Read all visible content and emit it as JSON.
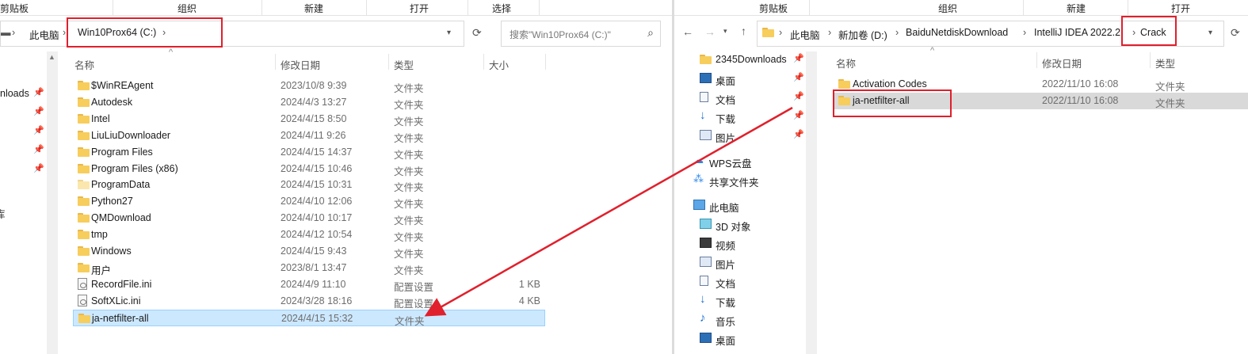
{
  "left": {
    "ribbon": {
      "clipboard": "剪贴板",
      "organize": "组织",
      "new": "新建",
      "open": "打开",
      "select": "选择"
    },
    "address": {
      "this_pc": "此电脑",
      "drive": "Win10Prox64 (C:)",
      "chev": "›"
    },
    "search_placeholder": "搜索\"Win10Prox64 (C:)\"",
    "nav": [
      {
        "label": "nloads",
        "pin": "📌"
      },
      {
        "label": "",
        "pin": "📌"
      },
      {
        "label": "",
        "pin": "📌"
      },
      {
        "label": "",
        "pin": "📌"
      },
      {
        "label": "",
        "pin": "📌"
      }
    ],
    "nav_fragment": "库",
    "columns": {
      "name": "名称",
      "date": "修改日期",
      "type": "类型",
      "size": "大小"
    },
    "rows": [
      {
        "name": "$WinREAgent",
        "date": "2023/10/8 9:39",
        "type": "文件夹",
        "size": "",
        "icon": "folder"
      },
      {
        "name": "Autodesk",
        "date": "2024/4/3 13:27",
        "type": "文件夹",
        "size": "",
        "icon": "folder"
      },
      {
        "name": "Intel",
        "date": "2024/4/15 8:50",
        "type": "文件夹",
        "size": "",
        "icon": "folder"
      },
      {
        "name": "LiuLiuDownloader",
        "date": "2024/4/11 9:26",
        "type": "文件夹",
        "size": "",
        "icon": "folder"
      },
      {
        "name": "Program Files",
        "date": "2024/4/15 14:37",
        "type": "文件夹",
        "size": "",
        "icon": "folder"
      },
      {
        "name": "Program Files (x86)",
        "date": "2024/4/15 10:46",
        "type": "文件夹",
        "size": "",
        "icon": "folder"
      },
      {
        "name": "ProgramData",
        "date": "2024/4/15 10:31",
        "type": "文件夹",
        "size": "",
        "icon": "folder-pale"
      },
      {
        "name": "Python27",
        "date": "2024/4/10 12:06",
        "type": "文件夹",
        "size": "",
        "icon": "folder"
      },
      {
        "name": "QMDownload",
        "date": "2024/4/10 10:17",
        "type": "文件夹",
        "size": "",
        "icon": "folder"
      },
      {
        "name": "tmp",
        "date": "2024/4/12 10:54",
        "type": "文件夹",
        "size": "",
        "icon": "folder"
      },
      {
        "name": "Windows",
        "date": "2024/4/15 9:43",
        "type": "文件夹",
        "size": "",
        "icon": "folder"
      },
      {
        "name": "用户",
        "date": "2023/8/1 13:47",
        "type": "文件夹",
        "size": "",
        "icon": "folder"
      },
      {
        "name": "RecordFile.ini",
        "date": "2024/4/9 11:10",
        "type": "配置设置",
        "size": "1 KB",
        "icon": "file"
      },
      {
        "name": "SoftXLic.ini",
        "date": "2024/3/28 18:16",
        "type": "配置设置",
        "size": "4 KB",
        "icon": "file"
      },
      {
        "name": "ja-netfilter-all",
        "date": "2024/4/15 15:32",
        "type": "文件夹",
        "size": "",
        "icon": "folder",
        "selected": true
      }
    ]
  },
  "right": {
    "ribbon": {
      "clipboard": "剪贴板",
      "organize": "组织",
      "new": "新建",
      "open": "打开"
    },
    "address": [
      "此电脑",
      "新加卷 (D:)",
      "BaiduNetdiskDownload",
      "IntelliJ IDEA 2022.2",
      "Crack"
    ],
    "nav": [
      {
        "label": "2345Downloads",
        "icon": "folder",
        "pin": "📌"
      },
      {
        "label": "桌面",
        "icon": "desktop",
        "pin": "📌"
      },
      {
        "label": "文档",
        "icon": "doc",
        "pin": "📌"
      },
      {
        "label": "下载",
        "icon": "download",
        "pin": "📌"
      },
      {
        "label": "图片",
        "icon": "picture",
        "pin": "📌"
      },
      {
        "label": "WPS云盘",
        "icon": "cloud",
        "pin": ""
      },
      {
        "label": "共享文件夹",
        "icon": "share",
        "pin": ""
      },
      {
        "label": "此电脑",
        "icon": "pc",
        "pin": ""
      },
      {
        "label": "3D 对象",
        "icon": "cube",
        "pin": ""
      },
      {
        "label": "视频",
        "icon": "video",
        "pin": ""
      },
      {
        "label": "图片",
        "icon": "picture",
        "pin": ""
      },
      {
        "label": "文档",
        "icon": "doc",
        "pin": ""
      },
      {
        "label": "下载",
        "icon": "download",
        "pin": ""
      },
      {
        "label": "音乐",
        "icon": "music",
        "pin": ""
      },
      {
        "label": "桌面",
        "icon": "desktop",
        "pin": ""
      }
    ],
    "columns": {
      "name": "名称",
      "date": "修改日期",
      "type": "类型"
    },
    "rows": [
      {
        "name": "Activation Codes",
        "date": "2022/11/10 16:08",
        "type": "文件夹"
      },
      {
        "name": "ja-netfilter-all",
        "date": "2022/11/10 16:08",
        "type": "文件夹",
        "hover": true
      }
    ]
  },
  "colors": {
    "selection": "#cce8ff",
    "highlight": "#e0202c",
    "folder": "#f7cd5c"
  }
}
